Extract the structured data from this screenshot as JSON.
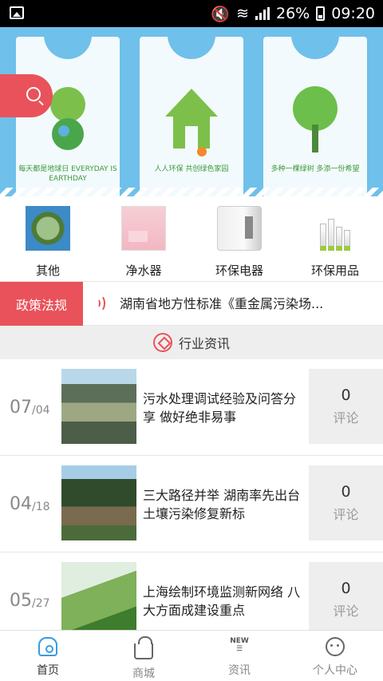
{
  "status_bar": {
    "battery": "26%",
    "time": "09:20"
  },
  "banner": {
    "bags": [
      {
        "caption": "每天都是地球日 EVERYDAY IS EARTHDAY"
      },
      {
        "caption": "人人环保 共创绿色家园"
      },
      {
        "caption": "多种一棵绿树 多添一份希望"
      }
    ]
  },
  "categories": [
    {
      "label": "其他"
    },
    {
      "label": "净水器"
    },
    {
      "label": "环保电器"
    },
    {
      "label": "环保用品"
    }
  ],
  "policy": {
    "tag": "政策法规",
    "headline": "湖南省地方性标准《重金属污染场..."
  },
  "section": {
    "title": "行业资讯"
  },
  "news": [
    {
      "date_day": "07",
      "date_sub": "/04",
      "title": "污水处理调试经验及问答分享 做好绝非易事",
      "comments": "0",
      "comment_label": "评论"
    },
    {
      "date_day": "04",
      "date_sub": "/18",
      "title": "三大路径并举 湖南率先出台土壤污染修复新标",
      "comments": "0",
      "comment_label": "评论"
    },
    {
      "date_day": "05",
      "date_sub": "/27",
      "title": "上海绘制环境监测新网络 八大方面成建设重点",
      "comments": "0",
      "comment_label": "评论"
    }
  ],
  "bottom_nav": [
    {
      "label": "首页",
      "icon": "home-icon"
    },
    {
      "label": "商城",
      "icon": "basket-icon"
    },
    {
      "label": "资讯",
      "icon": "news-icon",
      "badge": "NEW"
    },
    {
      "label": "个人中心",
      "icon": "user-icon"
    }
  ],
  "colors": {
    "accent": "#e9525a",
    "banner": "#6fc0ea",
    "nav_active": "#3a9be0"
  }
}
